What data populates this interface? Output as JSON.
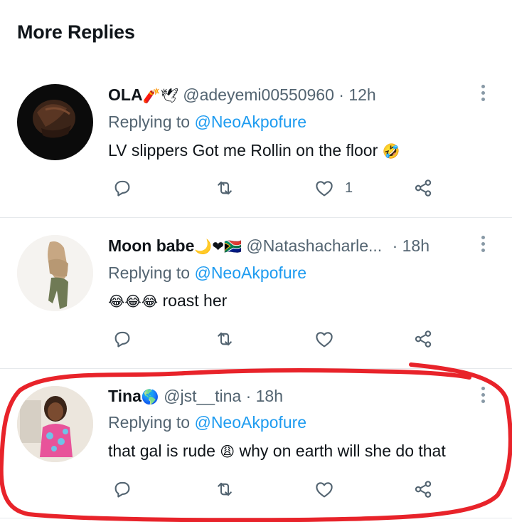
{
  "header": {
    "title": "More Replies"
  },
  "replying_prefix": "Replying to",
  "tweets": [
    {
      "name": "OLA",
      "name_emoji": "🧨🕊",
      "handle": "@adeyemi00550960",
      "separator": "·",
      "time": "12h",
      "reply_to": "@NeoAkpofure",
      "text": "LV slippers Got me Rollin on the floor",
      "text_emoji": "🤣",
      "like_count": "1"
    },
    {
      "name": "Moon babe",
      "name_emoji": "🌙❤🇿🇦",
      "handle": "@Natashacharle...",
      "separator": "·",
      "time": "18h",
      "reply_to": "@NeoAkpofure",
      "text_emoji": "😂😂😂",
      "text": "roast her",
      "like_count": ""
    },
    {
      "name": "Tina",
      "name_emoji": "🌎",
      "handle": "@jst__tina",
      "separator": "·",
      "time": "18h",
      "reply_to": "@NeoAkpofure",
      "text": "that gal is rude",
      "text_emoji": "😩",
      "text_after": "why on earth will she do that",
      "like_count": ""
    }
  ],
  "icons": [
    "reply-icon",
    "retweet-icon",
    "like-icon",
    "share-icon",
    "more-options-icon"
  ],
  "colors": {
    "link": "#1d9bf0",
    "secondary": "#536471",
    "annotation": "#e8232a"
  }
}
